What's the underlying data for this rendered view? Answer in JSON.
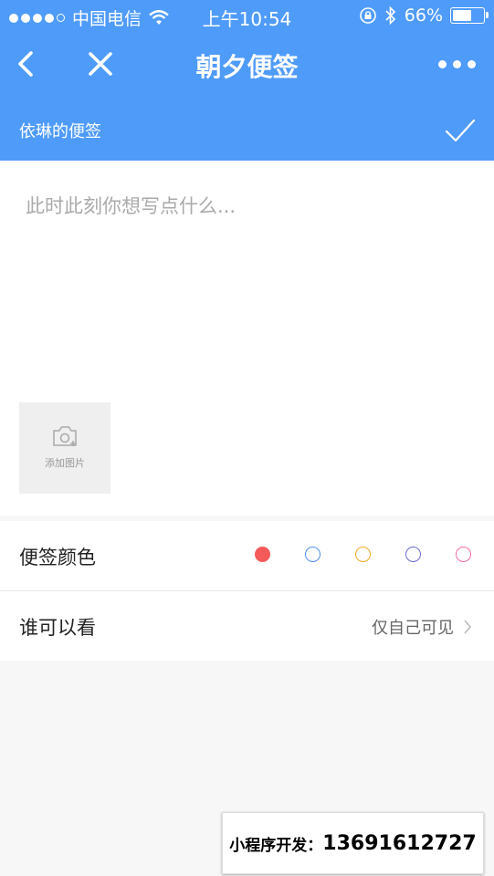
{
  "status": {
    "carrier": "中国电信",
    "time": "上午10:54",
    "battery_percent": "66%",
    "battery_level": 0.66
  },
  "nav": {
    "title": "朝夕便签"
  },
  "header": {
    "owner_title": "依琳的便签"
  },
  "editor": {
    "placeholder": "此时此刻你想写点什么...",
    "add_photo_label": "添加图片"
  },
  "settings": {
    "color_label": "便签颜色",
    "colors": [
      {
        "name": "red",
        "hex": "#f55a5a",
        "selected": true
      },
      {
        "name": "blue",
        "hex": "#4f8ff0",
        "selected": false
      },
      {
        "name": "orange",
        "hex": "#f5a623",
        "selected": false
      },
      {
        "name": "indigo",
        "hex": "#6b6bd8",
        "selected": false
      },
      {
        "name": "pink",
        "hex": "#f06aa8",
        "selected": false
      }
    ],
    "visibility_label": "谁可以看",
    "visibility_value": "仅自己可见"
  },
  "ad": {
    "prefix": "小程序开发：",
    "phone": "13691612727"
  },
  "theme": {
    "primary": "#4f9bf9"
  }
}
